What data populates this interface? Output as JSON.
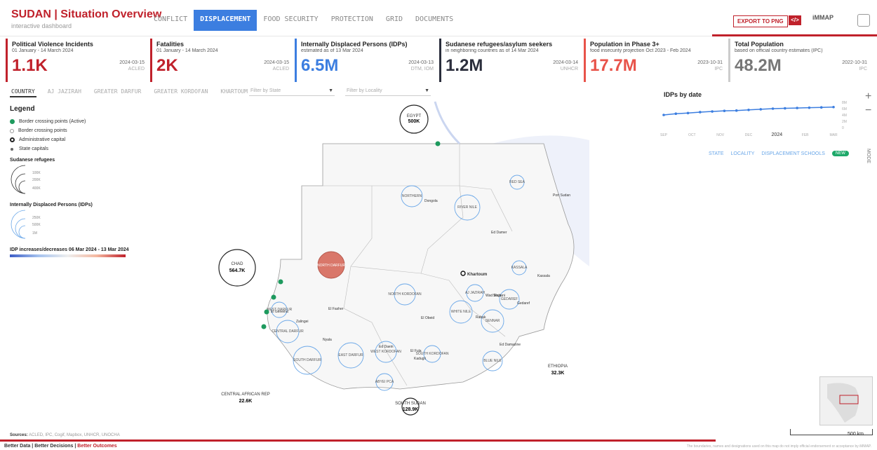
{
  "header": {
    "title": "SUDAN | Situation Overview",
    "subtitle": "interactive dashboard",
    "export_label": "EXPORT TO PNG",
    "code_icon": "</>",
    "partner": "iMMAP"
  },
  "nav": [
    "CONFLICT",
    "DISPLACEMENT",
    "FOOD SECURITY",
    "PROTECTION",
    "GRID",
    "DOCUMENTS"
  ],
  "kpis": [
    {
      "title": "Political Violence Incidents",
      "sub": "01 January - 14 March 2024",
      "value": "1.1K",
      "date": "2024-03-15",
      "src": "ACLED",
      "color": "#c0212b"
    },
    {
      "title": "Fatalities",
      "sub": "01 January - 14 March 2024",
      "value": "2K",
      "date": "2024-03-15",
      "src": "ACLED",
      "color": "#c0212b"
    },
    {
      "title": "Internally Displaced Persons (IDPs)",
      "sub": "estimated as of 13 Mar 2024",
      "value": "6.5M",
      "date": "2024-03-13",
      "src": "DTM, IOM",
      "color": "#3c7ee0"
    },
    {
      "title": "Sudanese refugees/asylum seekers",
      "sub": "in neighboring countries as of 14 Mar 2024",
      "value": "1.2M",
      "date": "2024-03-14",
      "src": "UNHCR",
      "color": "#2b2e3c"
    },
    {
      "title": "Population in Phase 3+",
      "sub": "food insecurity projection Oct 2023 - Feb 2024",
      "value": "17.7M",
      "date": "2023-10-31",
      "src": "IPC",
      "color": "#e8534a"
    },
    {
      "title": "Total Population",
      "sub": "based on official country estimates (IPC)",
      "value": "48.2M",
      "date": "2022-10-31",
      "src": "IPC",
      "color": "#777"
    }
  ],
  "tabs": [
    "COUNTRY",
    "AJ JAZIRAH",
    "GREATER DARFUR",
    "GREATER KORDOFAN",
    "KHARTOUM"
  ],
  "filters": {
    "state": "Filter by State",
    "locality": "Filter by Locality"
  },
  "legend": {
    "title": "Legend",
    "items": [
      "Border crossing points (Active)",
      "Border crossing points",
      "Administrative capital",
      "State capitals"
    ],
    "refugees_title": "Sudanese refugees",
    "refugees_ticks": [
      "100K",
      "200K",
      "400K"
    ],
    "idp_title": "Internally Displaced Persons (IDPs)",
    "idp_ticks": [
      "250K",
      "500K",
      "1M"
    ],
    "change_title": "IDP increases/decreases 06 Mar 2024 - 13 Mar 2024"
  },
  "map": {
    "countries": [
      {
        "name": "EGYPT",
        "value": "500K"
      },
      {
        "name": "CHAD",
        "value": "564.7K"
      },
      {
        "name": "ETHIOPIA",
        "value": "32.3K"
      },
      {
        "name": "CENTRAL AFRICAN REP",
        "value": "22.6K"
      },
      {
        "name": "SOUTH SUDAN",
        "value": "128.9K"
      }
    ],
    "states": [
      "RED SEA",
      "NORTHERN",
      "RIVER NILE",
      "NORTH DARFUR",
      "KHARTOUM",
      "KASSALA",
      "NORTH KORDOFAN",
      "AJ JAZIRAH",
      "GEDAREF",
      "WEST DARFUR",
      "CENTRAL DARFUR",
      "WHITE NILE",
      "SENNAR",
      "SOUTH DARFUR",
      "EAST DARFUR",
      "WEST KORDOFAN",
      "SOUTH KORDOFAN",
      "BLUE NILE",
      "ABYEI PCA"
    ],
    "cities": [
      "Port Sudan",
      "Dongola",
      "Ed Damer",
      "Khartoum",
      "Kassala",
      "Wad Madani",
      "Gedaref",
      "El Fasher",
      "El Obeid",
      "Rabak",
      "Zalingei",
      "Nyala",
      "Ed Daein",
      "Kadugli",
      "El Geneina",
      "Ed Damazine",
      "El Fula",
      "Sinja"
    ]
  },
  "chart_data": {
    "type": "line",
    "title": "IDPs by date",
    "x": [
      "SEP",
      "OCT",
      "NOV",
      "DEC",
      "2024",
      "FEB",
      "MAR"
    ],
    "y_ticks": [
      "8M",
      "6M",
      "4M",
      "2M",
      "0"
    ],
    "values": [
      4.0,
      4.4,
      4.6,
      4.9,
      5.1,
      5.3,
      5.4,
      5.6,
      5.8,
      6.0,
      6.1,
      6.2,
      6.3,
      6.4,
      6.5
    ],
    "color": "#3c7ee0"
  },
  "view": {
    "state": "STATE",
    "locality": "LOCALITY",
    "toggle_label": "DISPLACEMENT SCHOOLS",
    "pill": "NEW",
    "mode": "MODE"
  },
  "scale": "500 km",
  "sources": {
    "label": "Sources:",
    "text": "ACLED, IPC, Cogif, Mapbox, UNHCR, UNOCHA"
  },
  "footer": {
    "a": "Better Data | Better Decisions | ",
    "b": "Better Outcomes"
  },
  "disclaimer": "The boundaries, names and designations used on this map do not imply official endorsement or acceptance by iMMAP."
}
